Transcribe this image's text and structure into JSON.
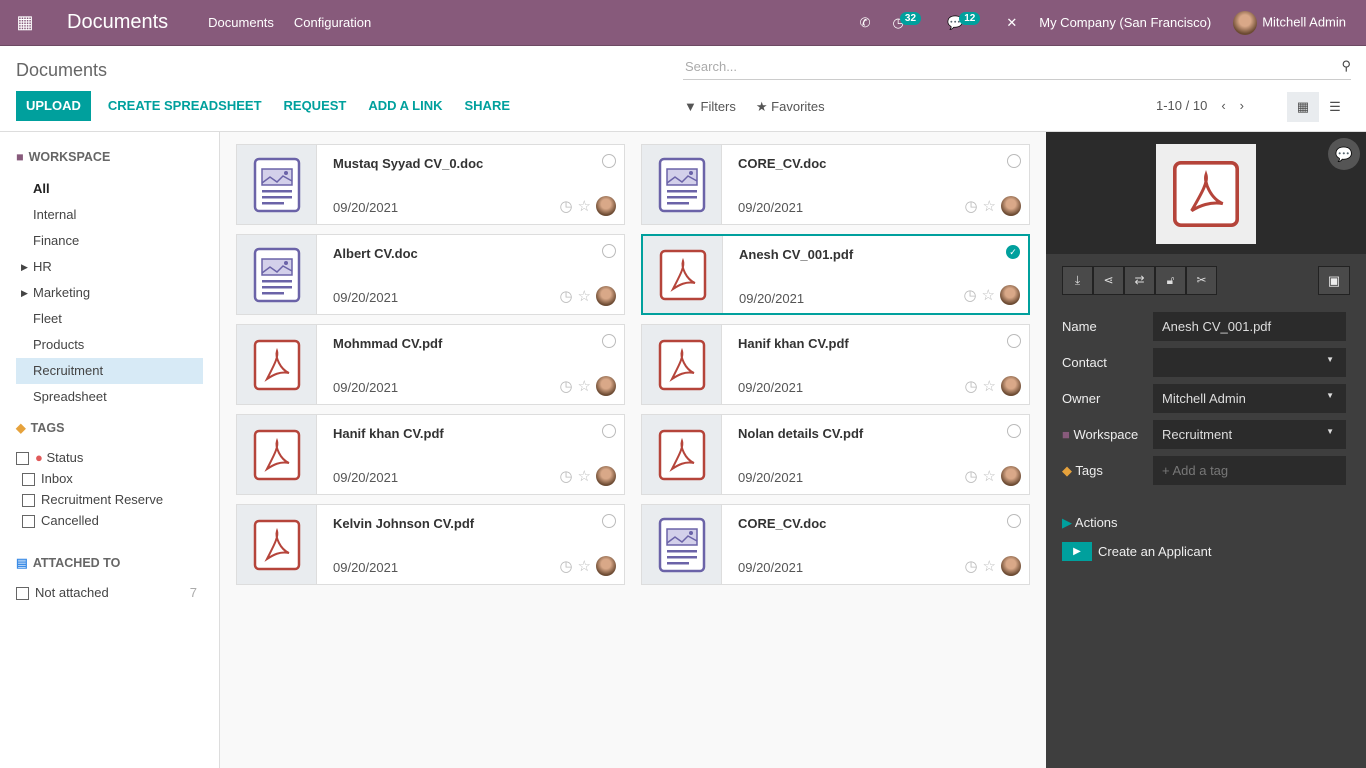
{
  "topbar": {
    "brand": "Documents",
    "menu": [
      "Documents",
      "Configuration"
    ],
    "activity_count": "32",
    "message_count": "12",
    "company": "My Company (San Francisco)",
    "user": "Mitchell Admin"
  },
  "control": {
    "title": "Documents",
    "search_placeholder": "Search...",
    "buttons": {
      "upload": "UPLOAD",
      "spreadsheet": "CREATE SPREADSHEET",
      "request": "REQUEST",
      "link": "ADD A LINK",
      "share": "SHARE"
    },
    "filters": "Filters",
    "favorites": "Favorites",
    "pager": "1-10 / 10"
  },
  "sidebar": {
    "workspace_title": "WORKSPACE",
    "workspaces": [
      {
        "label": "All",
        "bold": true
      },
      {
        "label": "Internal"
      },
      {
        "label": "Finance"
      },
      {
        "label": "HR",
        "caret": true
      },
      {
        "label": "Marketing",
        "caret": true
      },
      {
        "label": "Fleet"
      },
      {
        "label": "Products"
      },
      {
        "label": "Recruitment",
        "active": true
      },
      {
        "label": "Spreadsheet"
      }
    ],
    "tags_title": "TAGS",
    "tag_group": "Status",
    "tags": [
      "Inbox",
      "Recruitment Reserve",
      "Cancelled"
    ],
    "attached_title": "ATTACHED TO",
    "attached": {
      "label": "Not attached",
      "count": "7"
    }
  },
  "documents": [
    {
      "name": "Mustaq Syyad CV_0.doc",
      "date": "09/20/2021",
      "type": "doc"
    },
    {
      "name": "CORE_CV.doc",
      "date": "09/20/2021",
      "type": "doc"
    },
    {
      "name": "Albert CV.doc",
      "date": "09/20/2021",
      "type": "doc"
    },
    {
      "name": "Anesh CV_001.pdf",
      "date": "09/20/2021",
      "type": "pdf",
      "selected": true
    },
    {
      "name": "Mohmmad CV.pdf",
      "date": "09/20/2021",
      "type": "pdf"
    },
    {
      "name": "Hanif khan CV.pdf",
      "date": "09/20/2021",
      "type": "pdf"
    },
    {
      "name": "Hanif khan CV.pdf",
      "date": "09/20/2021",
      "type": "pdf"
    },
    {
      "name": "Nolan details CV.pdf",
      "date": "09/20/2021",
      "type": "pdf"
    },
    {
      "name": "Kelvin Johnson CV.pdf",
      "date": "09/20/2021",
      "type": "pdf"
    },
    {
      "name": "CORE_CV.doc",
      "date": "09/20/2021",
      "type": "doc"
    }
  ],
  "panel": {
    "fields": [
      {
        "label": "Name",
        "value": "Anesh CV_001.pdf"
      },
      {
        "label": "Contact",
        "value": "",
        "dropdown": true
      },
      {
        "label": "Owner",
        "value": "Mitchell Admin",
        "dropdown": true
      },
      {
        "label": "Workspace",
        "value": "Recruitment",
        "dropdown": true,
        "icon": "folder-icon"
      },
      {
        "label": "Tags",
        "placeholder": "+ Add a tag",
        "icon": "tag-icon"
      }
    ],
    "actions_label": "Actions",
    "action": "Create an Applicant"
  },
  "colors": {
    "brand": "#875a7b",
    "accent": "#00a09d",
    "pdf": "#b5443a",
    "doc": "#6b63a8"
  }
}
